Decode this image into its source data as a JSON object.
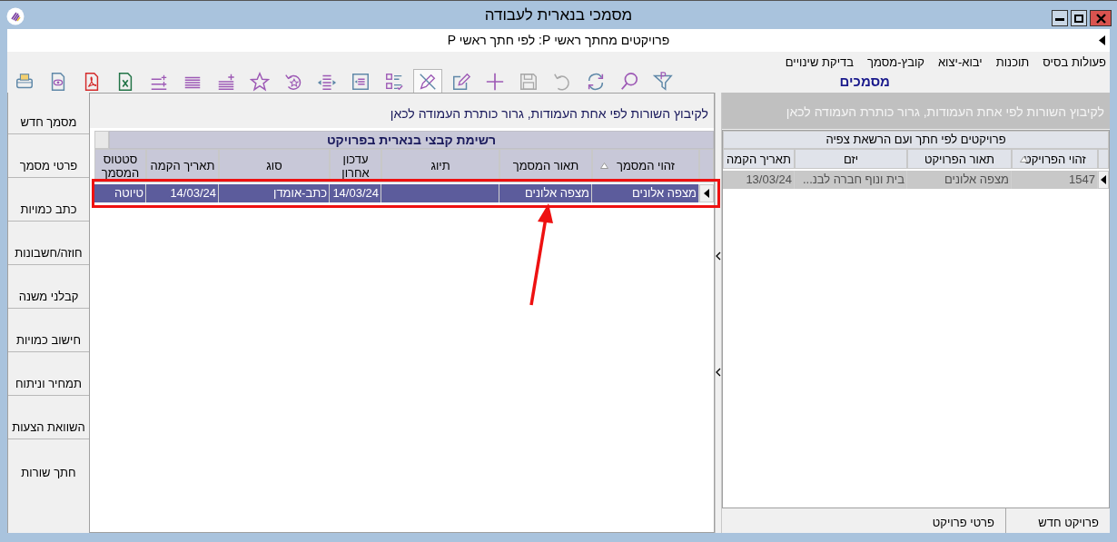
{
  "window": {
    "title": "מסמכי בנארית לעבודה"
  },
  "subheader": {
    "text": "פרויקטים מחתך ראשי P: לפי חתך ראשי P"
  },
  "menu": [
    "פעולות בסיס",
    "תוכנות",
    "יבוא-יצוא",
    "קובץ-מסמך",
    "בדיקת שינויים"
  ],
  "section_title": "מסמכים",
  "toolbar": [
    {
      "kind": "print",
      "selected": false,
      "disabled": false
    },
    {
      "kind": "preview",
      "selected": false,
      "disabled": false
    },
    {
      "kind": "pdf",
      "selected": false,
      "disabled": false
    },
    {
      "kind": "excel",
      "selected": false,
      "disabled": false
    },
    {
      "kind": "lines-plus",
      "selected": false,
      "disabled": false
    },
    {
      "kind": "lines",
      "selected": false,
      "disabled": false
    },
    {
      "kind": "lines-add",
      "selected": false,
      "disabled": false
    },
    {
      "kind": "star",
      "selected": false,
      "disabled": false
    },
    {
      "kind": "star-back",
      "selected": false,
      "disabled": false
    },
    {
      "kind": "width",
      "selected": false,
      "disabled": false
    },
    {
      "kind": "frame",
      "selected": false,
      "disabled": false
    },
    {
      "kind": "checklist",
      "selected": false,
      "disabled": false
    },
    {
      "kind": "pen-cross",
      "selected": true,
      "disabled": false
    },
    {
      "kind": "edit",
      "selected": false,
      "disabled": false
    },
    {
      "kind": "plus",
      "selected": false,
      "disabled": false
    },
    {
      "kind": "save",
      "selected": false,
      "disabled": true
    },
    {
      "kind": "undo",
      "selected": false,
      "disabled": true
    },
    {
      "kind": "refresh",
      "selected": false,
      "disabled": false
    },
    {
      "kind": "search",
      "selected": false,
      "disabled": false
    },
    {
      "kind": "filter",
      "selected": false,
      "disabled": false
    }
  ],
  "sidebar": {
    "items": [
      "מסמך חדש",
      "פרטי מסמך",
      "כתב כמויות",
      "חוזה/חשבונות",
      "קבלני משנה",
      "חישוב כמויות",
      "תמחיר וניתוח",
      "השוואת הצעות",
      "חתך שורות"
    ]
  },
  "documents": {
    "group_hint": "לקיבוץ השורות לפי אחת העמודות, גרור כותרת העמודה לכאן",
    "title": "רשימת קבצי בנארית בפרויקט",
    "columns": [
      {
        "label": "זהוי המסמך",
        "sorted": true
      },
      {
        "label": "תאור המסמך",
        "sorted": false
      },
      {
        "label": "תיוג",
        "sorted": false
      },
      {
        "label": "עדכון אחרון",
        "sorted": false
      },
      {
        "label": "סוג",
        "sorted": false
      },
      {
        "label": "תאריך הקמה",
        "sorted": false
      },
      {
        "label": "סטטוס המסמך",
        "sorted": false
      }
    ],
    "rows": [
      {
        "cells": [
          "מצפה אלונים",
          "מצפה אלונים",
          "",
          "14/03/24",
          "כתב-אומדן",
          "14/03/24",
          "טיוטה"
        ],
        "selected": true
      }
    ]
  },
  "projects": {
    "group_hint": "לקיבוץ השורות לפי אחת העמודות, גרור כותרת העמודה לכאן",
    "title": "פרויקטים לפי חתך ועם הרשאת צפיה",
    "columns": [
      {
        "label": "זהוי הפרויקט",
        "sorted": true
      },
      {
        "label": "תאור הפרויקט",
        "sorted": false
      },
      {
        "label": "יזם",
        "sorted": false
      },
      {
        "label": "תאריך הקמה",
        "sorted": false
      }
    ],
    "rows": [
      {
        "cells": [
          "1547",
          "מצפה אלונים",
          "בית ונוף חברה לבנ...",
          "13/03/24"
        ],
        "selected": true
      }
    ]
  },
  "project_buttons": [
    "פרויקט חדש",
    "פרטי פרויקט"
  ]
}
